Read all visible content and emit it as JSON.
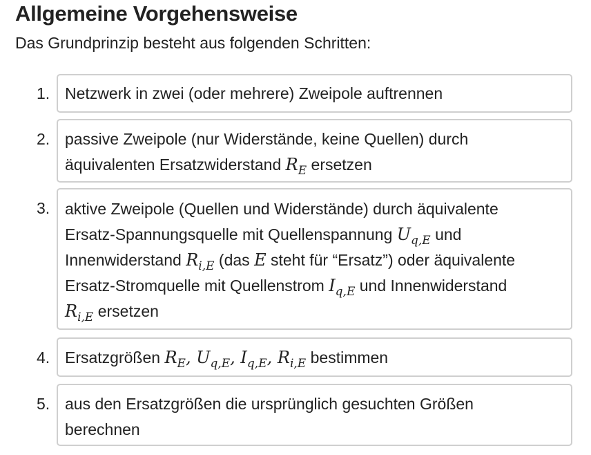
{
  "heading": "Allgemeine Vorgehensweise",
  "intro": "Das Grundprinzip besteht aus folgenden Schritten:",
  "steps": [
    {
      "number": "1.",
      "lines": [
        {
          "t1": "Netzwerk in zwei (oder mehrere) Zweipole auftrennen"
        }
      ]
    },
    {
      "number": "2.",
      "lines": [
        {
          "t1": "passive Zweipole (nur Widerstände, keine Quellen) durch"
        },
        {
          "t1": "äquivalenten Ersatzwiderstand ",
          "m1": "R",
          "s1": "E",
          "t2": " ersetzen"
        }
      ]
    },
    {
      "number": "3.",
      "lines": [
        {
          "t1": "aktive Zweipole (Quellen und Widerstände) durch äquivalente"
        },
        {
          "t1": "Ersatz-Spannungsquelle mit Quellenspannung ",
          "m1": "U",
          "s1": "q,E",
          "t2": " und"
        },
        {
          "t1": "Innenwiderstand ",
          "m1": "R",
          "s1": "i,E",
          "t2": " (das ",
          "m2": "E",
          "t3": " steht für “Ersatz”) oder äquivalente"
        },
        {
          "t1": "Ersatz-Stromquelle mit Quellenstrom ",
          "m1": "I",
          "s1": "q,E",
          "t2": " und Innenwiderstand"
        },
        {
          "m1": "R",
          "s1": "i,E",
          "t2": " ersetzen"
        }
      ]
    },
    {
      "number": "4.",
      "lines": [
        {
          "t1": "Ersatzgrößen ",
          "m1": "R",
          "s1": "E",
          "c1": ", ",
          "m2": "U",
          "s2": "q,E",
          "c2": ", ",
          "m3": "I",
          "s3": "q,E",
          "c3": ", ",
          "m4": "R",
          "s4": "i,E",
          "t2": " bestimmen"
        }
      ]
    },
    {
      "number": "5.",
      "lines": [
        {
          "t1": "aus den Ersatzgrößen die ursprünglich gesuchten Größen"
        },
        {
          "t1": "berechnen"
        }
      ]
    }
  ]
}
